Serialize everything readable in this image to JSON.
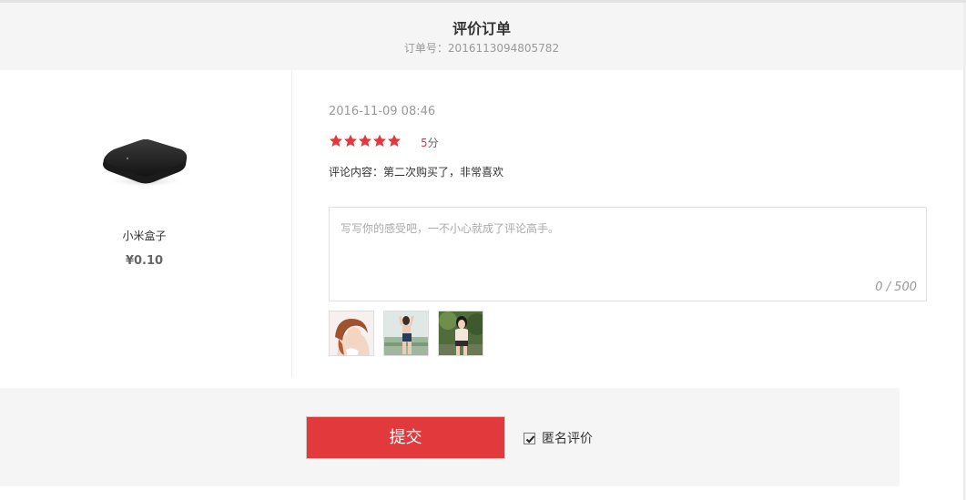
{
  "header": {
    "title": "评价订单",
    "order_label": "订单号：",
    "order_number": "2016113094805782"
  },
  "product": {
    "name": "小米盒子",
    "price": "¥0.10",
    "image_icon": "tv-box-image"
  },
  "review": {
    "date": "2016-11-09 08:46",
    "rating": 5,
    "rating_max": 5,
    "score_value": "5",
    "score_unit": "分",
    "comment": "评论内容：第二次购买了，非常喜欢",
    "star_color": "#e4393c"
  },
  "input": {
    "placeholder": "写写你的感受吧，一不小心就成了评论高手。",
    "counter": "0 / 500"
  },
  "photos": [
    "review-photo-1",
    "review-photo-2",
    "review-photo-3"
  ],
  "footer": {
    "submit_label": "提交",
    "anonymous_label": "匿名评价",
    "anonymous_checked": true,
    "accent_color": "#e2393c"
  }
}
